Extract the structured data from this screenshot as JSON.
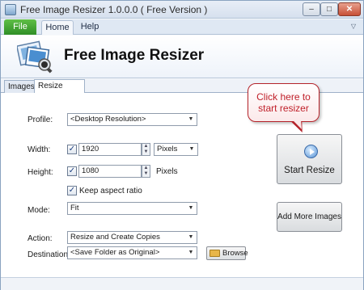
{
  "window": {
    "title": "Free Image Resizer 1.0.0.0 ( Free Version )",
    "min": "–",
    "max": "□",
    "close": "✕"
  },
  "ribbon": {
    "file": "File",
    "home": "Home",
    "help": "Help",
    "expand": "▽"
  },
  "banner": {
    "title": "Free Image Resizer"
  },
  "tabs": {
    "images": "Images",
    "resize_settings": "Resize Settings"
  },
  "form": {
    "profile_label": "Profile:",
    "profile_value": "<Desktop Resolution>",
    "width_label": "Width:",
    "width_value": "1920",
    "width_unit": "Pixels",
    "height_label": "Height:",
    "height_value": "1080",
    "height_unit": "Pixels",
    "keep_aspect_label": "Keep aspect ratio",
    "mode_label": "Mode:",
    "mode_value": "Fit",
    "action_label": "Action:",
    "action_value": "Resize and Create Copies",
    "destination_label": "Destination:",
    "destination_value": "<Save Folder as Original>",
    "browse_label": "Browse",
    "checkbox_checked": "✓"
  },
  "buttons": {
    "start_resize": "Start Resize",
    "add_more_images": "Add More Images"
  },
  "callout": {
    "line1": "Click here to",
    "line2": "start resizer"
  },
  "icons": {
    "dropdown": "▼",
    "spin_up": "▲",
    "spin_down": "▼"
  }
}
